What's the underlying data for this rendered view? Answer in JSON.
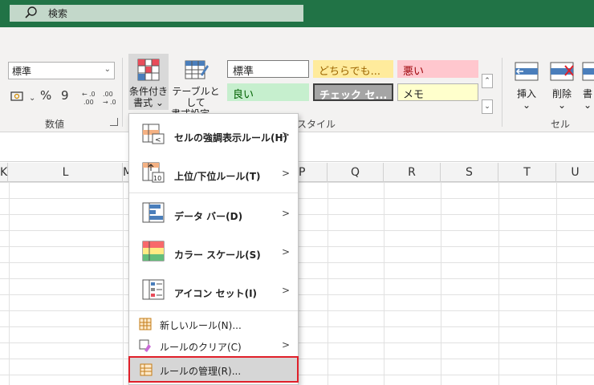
{
  "search": {
    "placeholder": "検索",
    "icon": "search-icon"
  },
  "ribbon": {
    "number_format": {
      "value": "標準"
    },
    "number_buttons": [
      "%",
      "9"
    ],
    "group_number": "数値",
    "group_styles": "スタイル",
    "group_cells": "セル",
    "conditional_format": {
      "line1": "条件付き",
      "line2": "書式 ⌄"
    },
    "format_as_table": {
      "line1": "テーブルとして",
      "line2": "書式設定 ⌄"
    },
    "styles": [
      {
        "label": "標準",
        "bg": "#ffffff",
        "fg": "#222222",
        "border": "#7a7a7a"
      },
      {
        "label": "どちらでも...",
        "bg": "#ffeb9c",
        "fg": "#9c6500",
        "border": "#ffeb9c"
      },
      {
        "label": "悪い",
        "bg": "#ffc7ce",
        "fg": "#9c0006",
        "border": "#ffc7ce"
      },
      {
        "label": "良い",
        "bg": "#c6efce",
        "fg": "#006100",
        "border": "#c6efce"
      },
      {
        "label": "チェック セ...",
        "bg": "#a5a5a5",
        "fg": "#ffffff",
        "border": "#3f3f3f"
      },
      {
        "label": "メモ",
        "bg": "#ffffcc",
        "fg": "#222222",
        "border": "#b2b2b2"
      }
    ],
    "insert": {
      "label": "挿入",
      "chev": "⌄"
    },
    "delete": {
      "label": "削除",
      "chev": "⌄"
    },
    "format": {
      "label": "書",
      "chev": "⌄"
    }
  },
  "columns": [
    "K",
    "L",
    "M",
    "P",
    "Q",
    "R",
    "S",
    "T",
    "U"
  ],
  "menu": {
    "items": [
      {
        "label": "セルの強調表示ルール(H)",
        "icon": "highlight-rules-icon"
      },
      {
        "label": "上位/下位ルール(T)",
        "icon": "top-bottom-rules-icon"
      },
      {
        "label": "データ バー(D)",
        "icon": "data-bars-icon"
      },
      {
        "label": "カラー スケール(S)",
        "icon": "color-scales-icon"
      },
      {
        "label": "アイコン セット(I)",
        "icon": "icon-sets-icon"
      }
    ],
    "small_items": [
      {
        "label": "新しいルール(N)...",
        "icon": "new-rule-icon"
      },
      {
        "label": "ルールのクリア(C)",
        "icon": "clear-rules-icon"
      },
      {
        "label": "ルールの管理(R)...",
        "icon": "manage-rules-icon"
      }
    ],
    "arrow": ">"
  },
  "colors": {
    "titlebar": "#217346",
    "highlight_border": "#e0202a"
  }
}
